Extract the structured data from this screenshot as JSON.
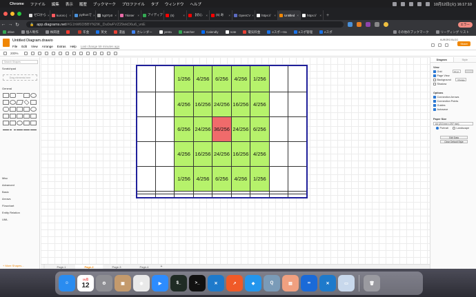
{
  "menubar": {
    "app_name": "Chrome",
    "items": [
      "ファイル",
      "編集",
      "表示",
      "履歴",
      "ブックマーク",
      "プロファイル",
      "タブ",
      "ウィンドウ",
      "ヘルプ"
    ],
    "clock": "10月12日(火) 16:17:10"
  },
  "tabs": [
    {
      "label": "ゼロから",
      "color": "#dddddd"
    },
    {
      "label": "kuroro |",
      "color": "#ff5a5f"
    },
    {
      "label": "pythonで",
      "color": "#4a90d9"
    },
    {
      "label": "5g0Tp0",
      "color": "#aaaaaa"
    },
    {
      "label": "Tkinter",
      "color": "#e96ba8"
    },
    {
      "label": "アイディア",
      "color": "#34a853"
    },
    {
      "label": "(5)",
      "color": "#ff0000"
    },
    {
      "label": "【初心",
      "color": "#ff0000"
    },
    {
      "label": "(5) 寿",
      "color": "#ff0000"
    },
    {
      "label": "OpenCV",
      "color": "#5c6bc0"
    },
    {
      "label": "https://",
      "color": "#ffffff"
    },
    {
      "label": "Untitled",
      "color": "#f08705",
      "active": true
    },
    {
      "label": "https://",
      "color": "#ffffff"
    }
  ],
  "address": {
    "url_host": "app.diagrams.net",
    "url_rest": "/#G1hM6DBBYN2IK_Du0wFVZ29ekD6u6_vnE"
  },
  "toolbar": {
    "error_label": "エラー"
  },
  "bookmarks": [
    {
      "label": "drive",
      "color": "#34a853"
    },
    {
      "label": "個人制作",
      "color": "#8e8e93"
    },
    {
      "label": "株関連",
      "color": "#8e8e93"
    },
    {
      "label": "",
      "color": "#ff3b30"
    },
    {
      "label": "年金",
      "color": "#c0392b"
    },
    {
      "label": "英文",
      "color": "#1a73e8"
    },
    {
      "label": "漫画",
      "color": "#e94235"
    },
    {
      "label": "カレンダー",
      "color": "#4285f4"
    },
    {
      "label": "yenta",
      "color": "#ffffff"
    },
    {
      "label": "matcher",
      "color": "#34a853"
    },
    {
      "label": "Calendly",
      "color": "#006bff"
    },
    {
      "label": "note",
      "color": "#ffffff"
    },
    {
      "label": "電気料金",
      "color": "#e94235"
    },
    {
      "label": "eスポーtra",
      "color": "#1a73e8"
    },
    {
      "label": "eスポ管理",
      "color": "#1a73e8"
    },
    {
      "label": "eスポ",
      "color": "#1a73e8"
    },
    {
      "label": "その他のブックマーク",
      "color": "#8e8e93"
    },
    {
      "label": "リーディング リスト",
      "color": "#8e8e93"
    }
  ],
  "drawio": {
    "title": "Untitled Diagram.drawio",
    "menus": [
      "File",
      "Edit",
      "View",
      "Arrange",
      "Extras",
      "Help"
    ],
    "unsaved": "Last change 59 minutes ago",
    "account": "KURORO BLOG",
    "share_label": "Share",
    "zoom": "200%",
    "search_placeholder": "Search Shapes",
    "scratchpad_label": "Scratchpad",
    "drag_here": "Drag elements here",
    "general_label": "General",
    "misc_label": "Misc",
    "advanced_label": "Advanced",
    "basic_label": "Basic",
    "arrows_label": "Arrows",
    "flowchart_label": "Flowchart",
    "entity_label": "Entity Relation",
    "uml_label": "UML",
    "more_shapes": "+ More Shapes...",
    "pages": [
      "Page-1",
      "Page-2",
      "Page-3",
      "Page-4"
    ],
    "active_page": 1
  },
  "grid": {
    "rows": [
      [
        "",
        "",
        "1/256",
        "4/256",
        "6/256",
        "4/256",
        "1/256",
        "",
        ""
      ],
      [
        "",
        "",
        "4/256",
        "16/256",
        "24/256",
        "16/256",
        "4/256",
        "",
        ""
      ],
      [
        "",
        "",
        "6/256",
        "24/256",
        "36/256",
        "24/256",
        "6/256",
        "",
        ""
      ],
      [
        "",
        "",
        "4/256",
        "16/256",
        "24/256",
        "16/256",
        "4/256",
        "",
        ""
      ],
      [
        "",
        "",
        "1/256",
        "4/256",
        "6/256",
        "4/256",
        "1/256",
        "",
        ""
      ],
      [
        "",
        "",
        "",
        "",
        "",
        "",
        "",
        "",
        ""
      ],
      [
        "",
        "",
        "",
        "",
        "",
        "",
        "",
        "",
        ""
      ]
    ],
    "highlight_color": "#b6f26b",
    "center_color": "#f06b6b",
    "border_color": "#1f1f9a"
  },
  "format_panel": {
    "tab_diagram": "Diagram",
    "tab_style": "Style",
    "view_label": "View",
    "grid_label": "Grid",
    "grid_size": "10 pt",
    "page_view_label": "Page View",
    "background_label": "Background",
    "change_label": "Change",
    "shadow_label": "Shadow",
    "options_label": "Options",
    "connection_arrows": "Connection Arrows",
    "connection_points": "Connection Points",
    "guides": "Guides",
    "autosave": "Autosave",
    "paper_size_label": "Paper Size",
    "paper_size": "A4 (210 mm x 297 mm)",
    "portrait": "Portrait",
    "landscape": "Landscape",
    "edit_data": "Edit Data",
    "clear_style": "Clear Default Style"
  },
  "dock": {
    "calendar_month": "10月",
    "calendar_day": "12",
    "apps": [
      {
        "name": "finder",
        "color": "#2a8cf0",
        "glyph": "☺"
      },
      {
        "name": "calendar",
        "color": "#ffffff",
        "glyph": ""
      },
      {
        "name": "system-prefs",
        "color": "#8e8e93",
        "glyph": "⚙"
      },
      {
        "name": "contacts",
        "color": "#c49a6c",
        "glyph": "▣"
      },
      {
        "name": "chrome",
        "color": "#e9e9e9",
        "glyph": "◉"
      },
      {
        "name": "zoom",
        "color": "#2d8cff",
        "glyph": "▶"
      },
      {
        "name": "terminal",
        "color": "#1f2b24",
        "glyph": "$_"
      },
      {
        "name": "terminal-2",
        "color": "#111111",
        "glyph": ">_"
      },
      {
        "name": "vscode",
        "color": "#1e7acb",
        "glyph": "✕"
      },
      {
        "name": "activity",
        "color": "#f05a28",
        "glyph": "↗"
      },
      {
        "name": "docker",
        "color": "#2396ed",
        "glyph": "◆"
      },
      {
        "name": "quicktime",
        "color": "#7a9bb8",
        "glyph": "Q"
      },
      {
        "name": "preview",
        "color": "#f0a080",
        "glyph": "▤"
      },
      {
        "name": "infinity",
        "color": "#1a6ad8",
        "glyph": "∞"
      },
      {
        "name": "vscode-2",
        "color": "#1e7acb",
        "glyph": "✕"
      },
      {
        "name": "screenshot",
        "color": "#c8d8ec",
        "glyph": "▭"
      },
      {
        "name": "trash",
        "color": "#9a9aa0",
        "glyph": "🗑"
      }
    ]
  }
}
